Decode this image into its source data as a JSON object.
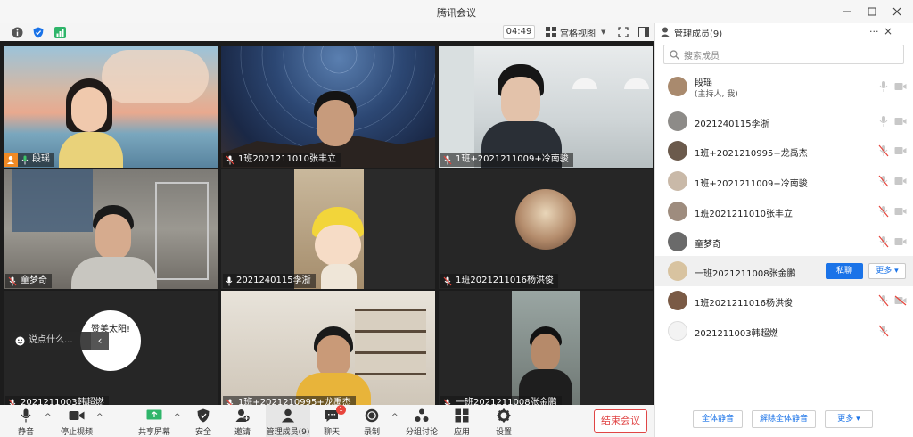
{
  "window": {
    "title": "腾讯会议"
  },
  "toolbar": {
    "timer": "04:49",
    "view_label": "宫格视图"
  },
  "tiles": [
    {
      "label": "段瑶",
      "muted": false
    },
    {
      "label": "1班2021211010张丰立",
      "muted": true
    },
    {
      "label": "1班+2021211009+冷南骏",
      "muted": true
    },
    {
      "label": "童梦奇",
      "muted": true
    },
    {
      "label": "2021240115李浙",
      "muted": false
    },
    {
      "label": "1班2021211016杨洪俊",
      "muted": true
    },
    {
      "label": "2021211003韩超燃",
      "muted": true
    },
    {
      "label": "1班+2021210995+龙禹杰",
      "muted": true
    },
    {
      "label": "一班2021211008张金鹏",
      "muted": true
    }
  ],
  "sticker_text": "赞美太阳!",
  "chat": {
    "placeholder": "说点什么..."
  },
  "bottombar": {
    "mute": "静音",
    "stop_video": "停止视频",
    "share": "共享屏幕",
    "security": "安全",
    "invite": "邀请",
    "manage": "管理成员(9)",
    "chat": "聊天",
    "chat_badge": "1",
    "record": "录制",
    "breakout": "分组讨论",
    "apps": "应用",
    "settings": "设置",
    "end": "结束会议"
  },
  "panel": {
    "title": "管理成员(9)",
    "search_placeholder": "搜索成员",
    "members": [
      {
        "name": "段瑶",
        "sub": "(主持人, 我)",
        "mic": "on",
        "cam": "on"
      },
      {
        "name": "2021240115李浙",
        "mic": "on",
        "cam": "on"
      },
      {
        "name": "1班+2021210995+龙禹杰",
        "mic": "off",
        "cam": "on"
      },
      {
        "name": "1班+2021211009+冷南骏",
        "mic": "off",
        "cam": "on"
      },
      {
        "name": "1班2021211010张丰立",
        "mic": "off",
        "cam": "on"
      },
      {
        "name": "童梦奇",
        "mic": "off",
        "cam": "on"
      },
      {
        "name": "一班2021211008张金鹏",
        "mic": "off",
        "cam": "on"
      },
      {
        "name": "1班2021211016杨洪俊",
        "mic": "off",
        "cam": "off"
      },
      {
        "name": "2021211003韩超燃",
        "mic": "off",
        "cam": "none"
      }
    ],
    "private_msg": "私聊",
    "more": "更多",
    "mute_all": "全体静音",
    "unmute_all": "解除全体静音",
    "footer_more": "更多"
  },
  "colors": {
    "accent": "#1a73e8",
    "danger": "#e04545",
    "badge": "#e8453c"
  }
}
